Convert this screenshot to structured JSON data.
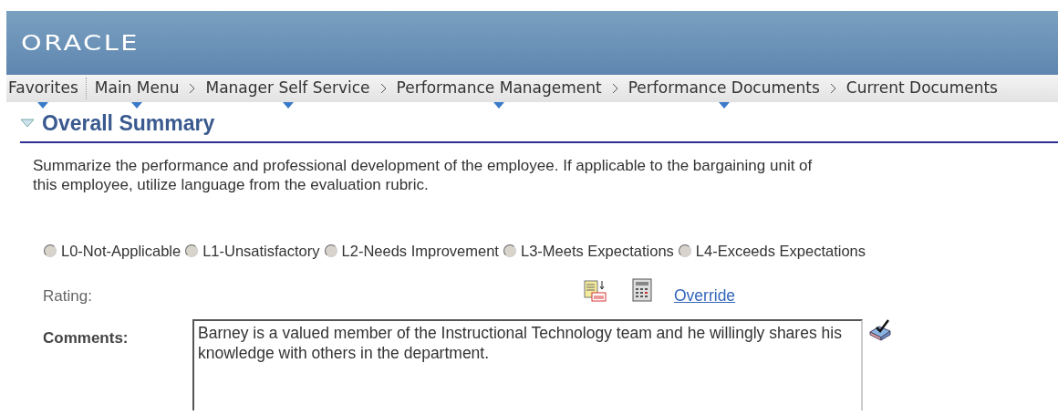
{
  "header": {
    "logo": "ORACLE"
  },
  "breadcrumbs": [
    {
      "label": "Favorites",
      "has_menu": true
    },
    {
      "label": "Main Menu",
      "has_menu": true
    },
    {
      "label": "Manager Self Service",
      "has_menu": true
    },
    {
      "label": "Performance Management",
      "has_menu": true
    },
    {
      "label": "Performance Documents",
      "has_menu": true
    },
    {
      "label": "Current Documents"
    }
  ],
  "section": {
    "title": "Overall Summary",
    "expanded": true,
    "description": "Summarize the performance and professional development of the employee. If applicable to the bargaining unit of this employee, utilize language from the evaluation rubric.",
    "ratings": [
      {
        "label": "L0-Not-Applicable",
        "selected": false
      },
      {
        "label": "L1-Unsatisfactory",
        "selected": false
      },
      {
        "label": "L2-Needs Improvement",
        "selected": false
      },
      {
        "label": "L3-Meets Expectations",
        "selected": false
      },
      {
        "label": "L4-Exceeds Expectations",
        "selected": false
      }
    ],
    "rating_label": "Rating:",
    "override_link": "Override",
    "comments_label": "Comments:",
    "comments": "Barney is a valued member of the Instructional Technology team and he willingly shares his knowledge with others in the department. "
  }
}
